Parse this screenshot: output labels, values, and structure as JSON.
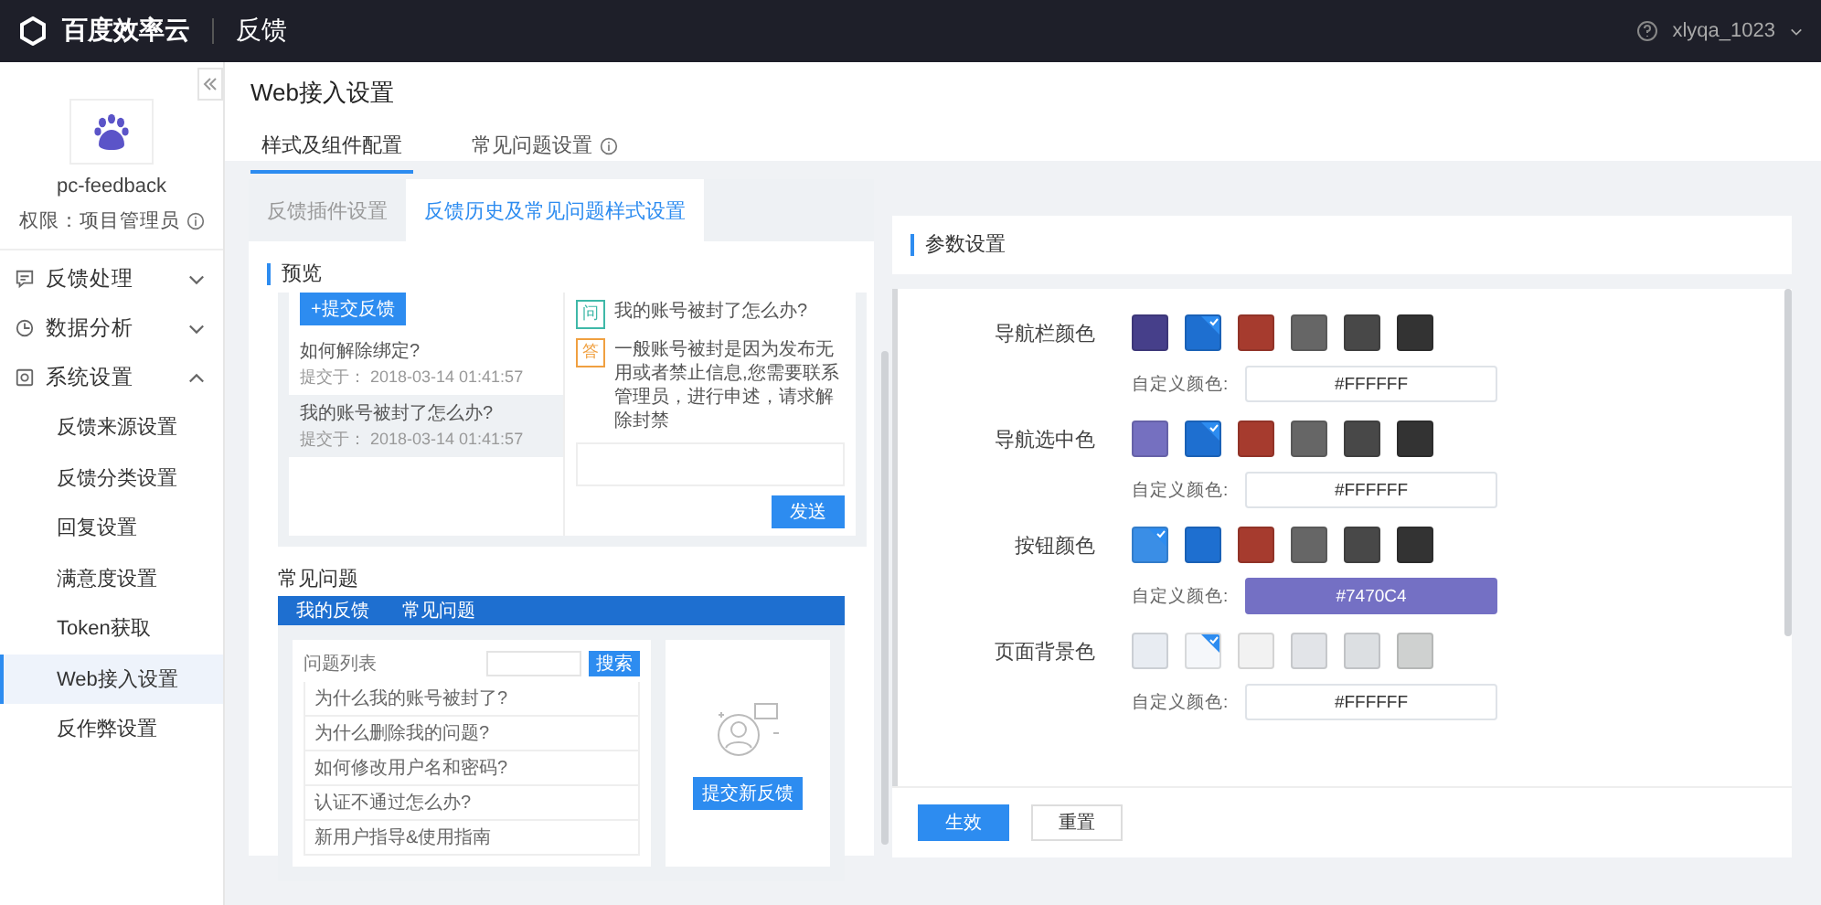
{
  "topbar": {
    "brand": "百度效率云",
    "product": "反馈",
    "user": "xlyqa_1023"
  },
  "sidebar": {
    "project": "pc-feedback",
    "role": "权限：项目管理员",
    "nav": [
      {
        "label": "反馈处理",
        "expanded": false
      },
      {
        "label": "数据分析",
        "expanded": false
      },
      {
        "label": "系统设置",
        "expanded": true,
        "children": [
          {
            "label": "反馈来源设置",
            "selected": false
          },
          {
            "label": "反馈分类设置",
            "selected": false
          },
          {
            "label": "回复设置",
            "selected": false
          },
          {
            "label": "满意度设置",
            "selected": false
          },
          {
            "label": "Token获取",
            "selected": false
          },
          {
            "label": "Web接入设置",
            "selected": true
          },
          {
            "label": "反作弊设置",
            "selected": false
          }
        ]
      }
    ]
  },
  "page": {
    "title": "Web接入设置",
    "tabs": [
      {
        "label": "样式及组件配置",
        "selected": true,
        "info": false
      },
      {
        "label": "常见问题设置",
        "selected": false,
        "info": true
      }
    ],
    "subtabs": [
      {
        "label": "反馈插件设置",
        "selected": false
      },
      {
        "label": "反馈历史及常见问题样式设置",
        "selected": true
      }
    ]
  },
  "preview": {
    "title": "预览",
    "history": {
      "new_button": "+提交反馈",
      "items": [
        {
          "title": "如何解除绑定?",
          "time": "提交于： 2018-03-14 01:41:57",
          "selected": false
        },
        {
          "title": "我的账号被封了怎么办?",
          "time": "提交于： 2018-03-14 01:41:57",
          "selected": true
        }
      ],
      "messages": [
        {
          "kind": "question",
          "badge": "问",
          "text": "我的账号被封了怎么办?"
        },
        {
          "kind": "answer",
          "badge": "答",
          "text": "一般账号被封是因为发布无用或者禁止信息,您需要联系管理员，进行申述，请求解除封禁"
        }
      ],
      "send_button": "发送"
    },
    "faq": {
      "title": "常见问题",
      "nav": [
        "我的反馈",
        "常见问题"
      ],
      "list_label": "问题列表",
      "search_button": "搜索",
      "questions": [
        "为什么我的账号被封了?",
        "为什么删除我的问题?",
        "如何修改用户名和密码?",
        "认证不通过怎么办?",
        "新用户指导&使用指南"
      ],
      "submit_button": "提交新反馈"
    }
  },
  "settings": {
    "title": "参数设置",
    "groups": [
      {
        "label": "导航栏颜色",
        "swatches": [
          {
            "color": "#463f8a",
            "selected": false
          },
          {
            "color": "#1e6fd0",
            "selected": true
          },
          {
            "color": "#a63b2e",
            "selected": false
          },
          {
            "color": "#666666",
            "selected": false
          },
          {
            "color": "#484848",
            "selected": false
          },
          {
            "color": "#333333",
            "selected": false
          }
        ],
        "custom": {
          "label": "自定义颜色:",
          "value": "#FFFFFF"
        }
      },
      {
        "label": "导航选中色",
        "swatches": [
          {
            "color": "#7570c0",
            "selected": false
          },
          {
            "color": "#1e6fd0",
            "selected": true
          },
          {
            "color": "#a63b2e",
            "selected": false
          },
          {
            "color": "#666666",
            "selected": false
          },
          {
            "color": "#484848",
            "selected": false
          },
          {
            "color": "#333333",
            "selected": false
          }
        ],
        "custom": {
          "label": "自定义颜色:",
          "value": "#FFFFFF"
        }
      },
      {
        "label": "按钮颜色",
        "swatches": [
          {
            "color": "#3a8ee6",
            "selected": true
          },
          {
            "color": "#1e6fd0",
            "selected": false
          },
          {
            "color": "#a63b2e",
            "selected": false
          },
          {
            "color": "#666666",
            "selected": false
          },
          {
            "color": "#484848",
            "selected": false
          },
          {
            "color": "#333333",
            "selected": false
          }
        ],
        "custom": {
          "label": "自定义颜色:",
          "value": "#7470C4",
          "color": "#7470c4"
        }
      },
      {
        "label": "页面背景色",
        "swatches": [
          {
            "color": "#e8ecf2",
            "selected": false
          },
          {
            "color": "#f5f7fa",
            "selected": true
          },
          {
            "color": "#f2f2f2",
            "selected": false
          },
          {
            "color": "#e2e4e8",
            "selected": false
          },
          {
            "color": "#dcdfe2",
            "selected": false
          },
          {
            "color": "#cfd1d0",
            "selected": false
          }
        ],
        "custom": {
          "label": "自定义颜色:",
          "value": "#FFFFFF"
        }
      }
    ],
    "apply_button": "生效",
    "reset_button": "重置"
  }
}
